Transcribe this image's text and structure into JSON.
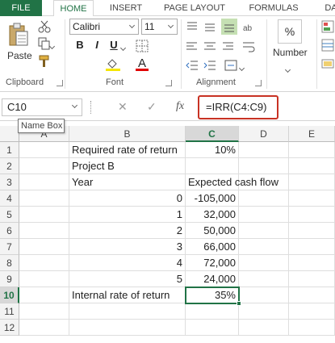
{
  "ribbon": {
    "tabs": [
      "FILE",
      "HOME",
      "INSERT",
      "PAGE LAYOUT",
      "FORMULAS",
      "DA"
    ],
    "active_tab": "HOME",
    "clipboard": {
      "paste_label": "Paste",
      "group_label": "Clipboard"
    },
    "font": {
      "name": "Calibri",
      "size": "11",
      "group_label": "Font",
      "bold": "B",
      "italic": "I",
      "underline": "U",
      "font_color_glyph": "A"
    },
    "alignment": {
      "group_label": "Alignment"
    },
    "number": {
      "label": "Number",
      "icon_glyph": "%"
    }
  },
  "formula_bar": {
    "name_box": "C10",
    "formula": "=IRR(C4:C9)",
    "fx_glyph": "fx",
    "cancel_glyph": "✕",
    "enter_glyph": "✓",
    "name_box_tooltip": "Name Box"
  },
  "sheet": {
    "columns": [
      "A",
      "B",
      "C",
      "D",
      "E"
    ],
    "selected_column": "C",
    "rows": [
      "1",
      "2",
      "3",
      "4",
      "5",
      "6",
      "7",
      "8",
      "9",
      "10",
      "11",
      "12"
    ],
    "selected_row": "10",
    "cells": {
      "B1": "Required rate of return",
      "C1": "10%",
      "B2": "Project B",
      "B3": "Year",
      "C3": "Expected cash flow",
      "B4": "0",
      "C4": "-105,000",
      "B5": "1",
      "C5": "32,000",
      "B6": "2",
      "C6": "50,000",
      "B7": "3",
      "C7": "66,000",
      "B8": "4",
      "C8": "72,000",
      "B9": "5",
      "C9": "24,000",
      "B10": "Internal rate of return",
      "C10": "35%"
    }
  },
  "colors": {
    "accent": "#217346",
    "highlight_border": "#c83224"
  }
}
